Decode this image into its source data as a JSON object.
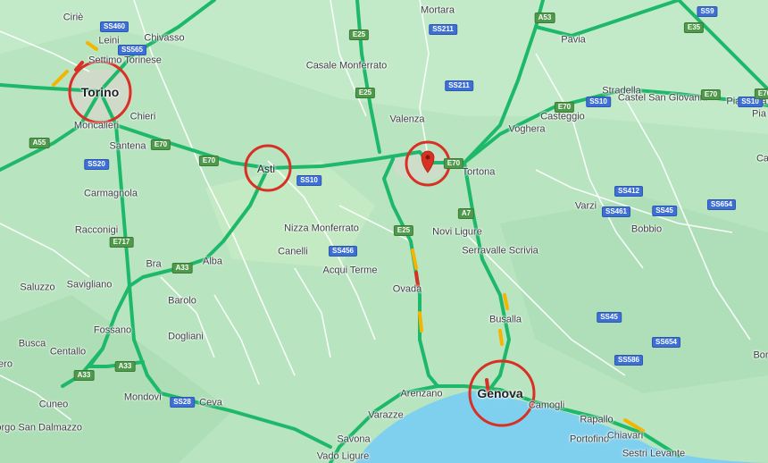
{
  "map": {
    "colors": {
      "land": "#b8e4c0",
      "water": "#7fd0ee",
      "highway": "#1db86a",
      "road": "#ffffff",
      "traffic_slow": "#f5b400",
      "traffic_jam": "#d93025",
      "highlight": "#d93025",
      "pin": "#d93025"
    },
    "highlighted_places": [
      "Torino",
      "Asti",
      "Genova"
    ],
    "pin_icon": "location-pin-icon",
    "places": [
      {
        "name": "Ciriè",
        "size": "small"
      },
      {
        "name": "Leini",
        "size": "small"
      },
      {
        "name": "Chivasso",
        "size": "small"
      },
      {
        "name": "Settimo Torinese",
        "size": "small"
      },
      {
        "name": "Torino",
        "size": "major"
      },
      {
        "name": "Moncalieri",
        "size": "small"
      },
      {
        "name": "Chieri",
        "size": "small"
      },
      {
        "name": "Santena",
        "size": "small"
      },
      {
        "name": "Carmagnola",
        "size": "small"
      },
      {
        "name": "Racconigi",
        "size": "small"
      },
      {
        "name": "Savigliano",
        "size": "small"
      },
      {
        "name": "Saluzzo",
        "size": "small"
      },
      {
        "name": "Fossano",
        "size": "small"
      },
      {
        "name": "Busca",
        "size": "small"
      },
      {
        "name": "Centallo",
        "size": "small"
      },
      {
        "name": "Cuneo",
        "size": "small"
      },
      {
        "name": "Borgo San Dalmazzo",
        "size": "small"
      },
      {
        "name": "Mondovì",
        "size": "small"
      },
      {
        "name": "Bra",
        "size": "small"
      },
      {
        "name": "Alba",
        "size": "small"
      },
      {
        "name": "Barolo",
        "size": "small"
      },
      {
        "name": "Dogliani",
        "size": "small"
      },
      {
        "name": "Ceva",
        "size": "small"
      },
      {
        "name": "Asti",
        "size": "mid"
      },
      {
        "name": "Nizza Monferrato",
        "size": "small"
      },
      {
        "name": "Canelli",
        "size": "small"
      },
      {
        "name": "Acqui Terme",
        "size": "small"
      },
      {
        "name": "Casale Monferrato",
        "size": "small"
      },
      {
        "name": "Mortara",
        "size": "small"
      },
      {
        "name": "Valenza",
        "size": "small"
      },
      {
        "name": "Tortona",
        "size": "small"
      },
      {
        "name": "Voghera",
        "size": "small"
      },
      {
        "name": "Casteggio",
        "size": "small"
      },
      {
        "name": "Stradella",
        "size": "small"
      },
      {
        "name": "Castel San Giovanni",
        "size": "small"
      },
      {
        "name": "Piacenza",
        "size": "small"
      },
      {
        "name": "Pavia",
        "size": "small"
      },
      {
        "name": "Novi Ligure",
        "size": "small"
      },
      {
        "name": "Serravalle Scrivia",
        "size": "small"
      },
      {
        "name": "Ovada",
        "size": "small"
      },
      {
        "name": "Busalla",
        "size": "small"
      },
      {
        "name": "Varzi",
        "size": "small"
      },
      {
        "name": "Bobbio",
        "size": "small"
      },
      {
        "name": "Arenzano",
        "size": "small"
      },
      {
        "name": "Varazze",
        "size": "small"
      },
      {
        "name": "Savona",
        "size": "small"
      },
      {
        "name": "Vado Ligure",
        "size": "small"
      },
      {
        "name": "Genova",
        "size": "major"
      },
      {
        "name": "Camogli",
        "size": "small"
      },
      {
        "name": "Rapallo",
        "size": "small"
      },
      {
        "name": "Portofino",
        "size": "small"
      },
      {
        "name": "Chiavari",
        "size": "small"
      },
      {
        "name": "Sestri Levante",
        "size": "small"
      },
      {
        "name": "Bor",
        "size": "small"
      },
      {
        "name": "Ca",
        "size": "small"
      },
      {
        "name": "Pia",
        "size": "small"
      },
      {
        "name": "ero",
        "size": "small"
      }
    ],
    "shields": [
      "SS460",
      "SS565",
      "E25",
      "SS211",
      "A53",
      "SS9",
      "E35",
      "E70",
      "A55",
      "SS20",
      "E70",
      "E70",
      "SS10",
      "E25",
      "SS211",
      "E70",
      "SS10",
      "SS10",
      "E70",
      "E717",
      "A33",
      "SS456",
      "E25",
      "A7",
      "SS412",
      "SS461",
      "SS45",
      "SS654",
      "A33",
      "A33",
      "SS28",
      "SS45",
      "SS586",
      "SS654",
      "E70"
    ]
  }
}
